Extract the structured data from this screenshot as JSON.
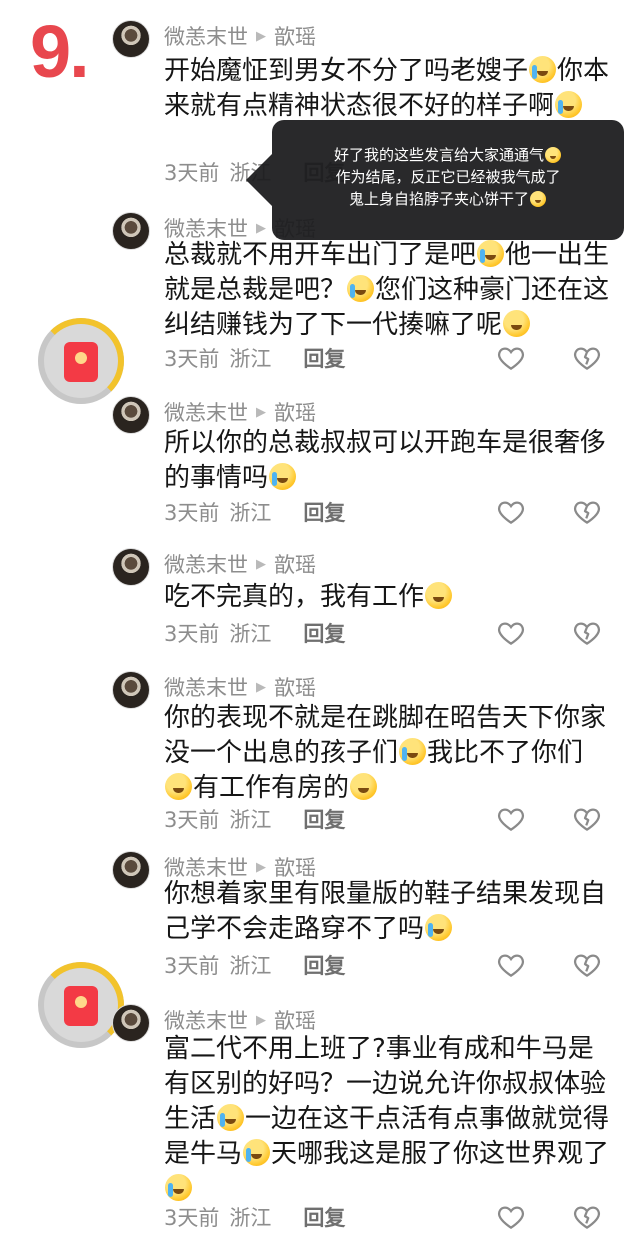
{
  "page_number": "9.",
  "user_name": "微恙末世",
  "reply_to": "歆瑶",
  "time": "3天前",
  "region": "浙江",
  "reply_label": "回复",
  "tooltip": {
    "line1": "好了我的这些发言给大家通通气",
    "line2": "作为结尾，反正它已经被我气成了",
    "line3": "鬼上身自掐脖子夹心饼干了"
  },
  "comments": [
    {
      "segments": [
        "开始魔怔到男女不分了吗老嫂子",
        "你本来就有点精神状态很不好的样子啊",
        ""
      ]
    },
    {
      "segments": [
        "总裁就不用开车出门了是吧",
        "他一出生就是总裁是吧？",
        "您们这种豪门还在这纠结赚钱为了下一代揍嘛了呢",
        ""
      ]
    },
    {
      "segments": [
        "所以你的总裁叔叔可以开跑车是很奢侈的事情吗",
        ""
      ]
    },
    {
      "segments": [
        "吃不完真的，我有工作",
        ""
      ]
    },
    {
      "segments": [
        "你的表现不就是在跳脚在昭告天下你家没一个出息的孩子们",
        "我比不了你们",
        "有工作有房的",
        ""
      ]
    },
    {
      "segments": [
        "你想着家里有限量版的鞋子结果发现自己学不会走路穿不了吗",
        ""
      ]
    },
    {
      "segments": [
        "富二代不用上班了?事业有成和牛马是有区别的好吗？一边说允许你叔叔体验生活",
        "一边在这干点活有点事做就觉得是牛马",
        "天哪我这是服了你这世界观了",
        ""
      ]
    }
  ]
}
